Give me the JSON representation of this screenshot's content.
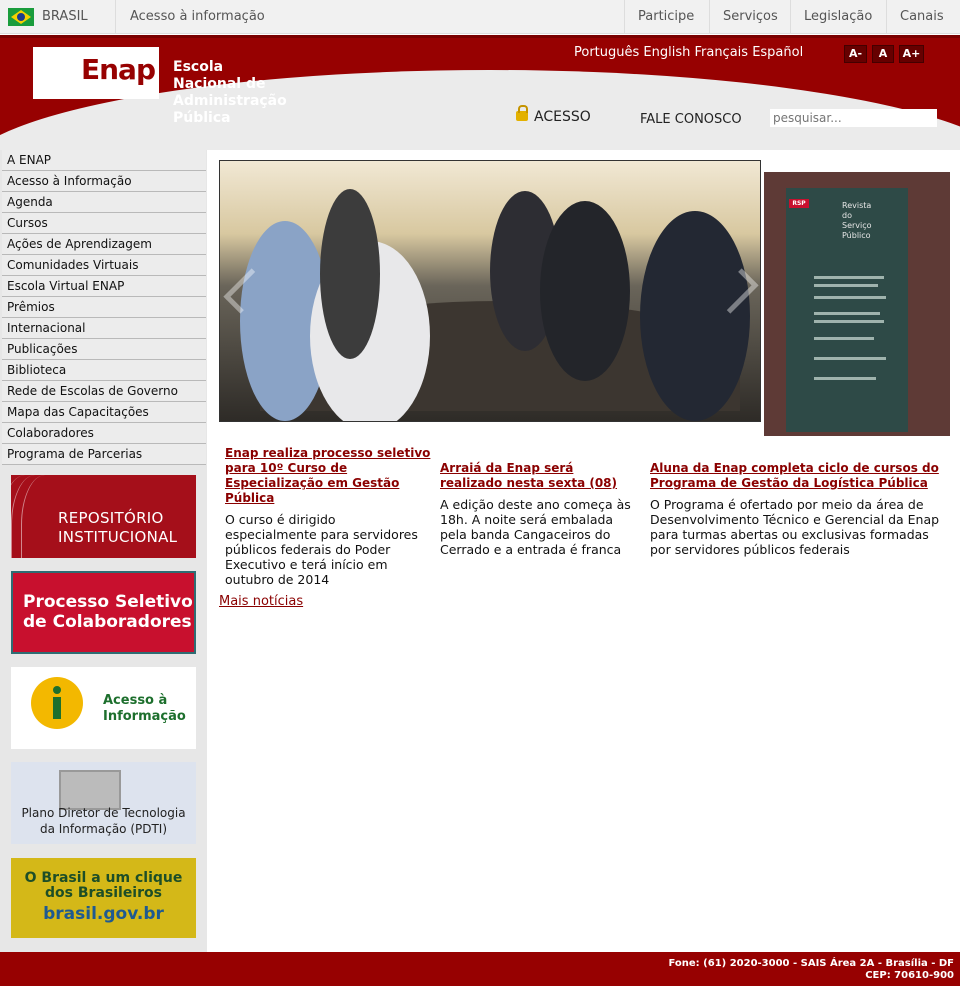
{
  "gov_bar": {
    "country": "BRASIL",
    "access_info": "Acesso à informação",
    "links": [
      "Participe",
      "Serviços",
      "Legislação",
      "Canais"
    ]
  },
  "header": {
    "logo_word": "Enap",
    "logo_lines": [
      "Escola",
      "Nacional de",
      "Administração",
      "Pública"
    ],
    "languages": "Português English Français Español",
    "font_buttons": [
      "A-",
      "A",
      "A+"
    ],
    "access_label": "ACESSO",
    "contact_label": "FALE CONOSCO",
    "search_placeholder": "pesquisar..."
  },
  "menu": [
    "A ENAP",
    "Acesso à Informação",
    "Agenda",
    "Cursos",
    "Ações de Aprendizagem",
    "Comunidades Virtuais",
    "Escola Virtual ENAP",
    "Prêmios",
    "Internacional",
    "Publicações",
    "Biblioteca",
    "Rede de Escolas de Governo",
    "Mapa das Capacitações",
    "Colaboradores",
    "Programa de Parcerias"
  ],
  "banners": {
    "repositorio": [
      "REPOSITÓRIO",
      "INSTITUCIONAL"
    ],
    "processo": [
      "Processo Seletivo",
      "de Colaboradores"
    ],
    "acesso": [
      "Acesso à",
      "Informação"
    ],
    "pdti": [
      "Plano Diretor de Tecnologia",
      "da Informação (PDTI)"
    ],
    "brasil": [
      "O Brasil a um clique",
      "dos Brasileiros",
      "brasil.gov.br"
    ]
  },
  "magazine": {
    "tag": "RSP",
    "title": [
      "Revista",
      "do",
      "Serviço",
      "Público"
    ]
  },
  "news": [
    {
      "title": "Enap realiza processo seletivo para 10º Curso de Especialização em Gestão Pública",
      "summary": "O curso é dirigido especialmente para servidores públicos federais do Poder Executivo e terá início em outubro de 2014"
    },
    {
      "title": "Arraiá da Enap será realizado nesta sexta (08)",
      "summary": "A edição deste ano começa às 18h. A noite será embalada pela banda Cangaceiros do Cerrado e a entrada é franca"
    },
    {
      "title": "Aluna da Enap completa ciclo de cursos do Programa de Gestão da Logística Pública",
      "summary": "O Programa é ofertado por meio da área de Desenvolvimento Técnico e Gerencial da Enap para turmas abertas ou exclusivas formadas por servidores públicos federais"
    }
  ],
  "more_news": "Mais notícias",
  "footer": {
    "line1": "Fone: (61) 2020-3000 - SAIS Área 2A - Brasília - DF",
    "line2": "CEP: 70610-900"
  }
}
